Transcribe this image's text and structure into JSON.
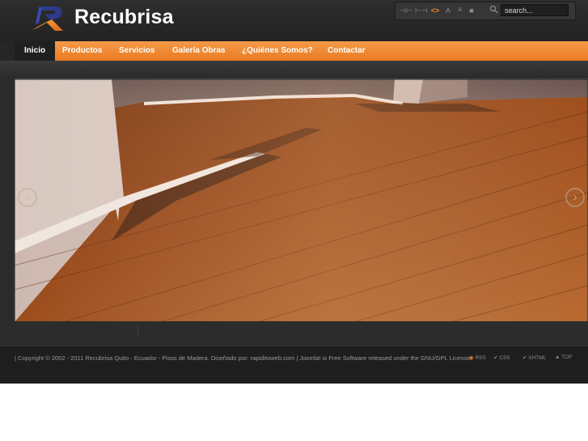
{
  "brand": {
    "name": "Recubrisa",
    "accent_color": "#f08a2a"
  },
  "toolbar": {
    "icons": [
      {
        "name": "decrease-width-icon",
        "glyph": "⊣⊢"
      },
      {
        "name": "increase-width-icon",
        "glyph": "⊢⊣"
      },
      {
        "name": "code-icon",
        "glyph": "<>"
      },
      {
        "name": "font-larger-icon",
        "glyph": "A"
      },
      {
        "name": "font-smaller-icon",
        "glyph": "A"
      },
      {
        "name": "stop-icon",
        "glyph": "■"
      }
    ],
    "search_placeholder": "search..."
  },
  "nav": {
    "items": [
      {
        "label": "Inicio",
        "active": true
      },
      {
        "label": "Productos"
      },
      {
        "label": "Servicios"
      },
      {
        "label": "Galería Obras"
      },
      {
        "label": "¿Quiénes Somos?"
      },
      {
        "label": "Contactar"
      }
    ]
  },
  "slideshow": {
    "prev_glyph": "‹",
    "next_glyph": "›"
  },
  "footer": {
    "copyright": "| Copyright © 2002 - 2011 Recubrisa Quito - Ecuador - Pisos de Madera. Diseñado por: rapiditoweb.com   |  Joomla! is Free Software released under the GNU/GPL License.",
    "links": {
      "rss": "RSS",
      "css": "CSS",
      "xhtml": "XHTML",
      "top": "TOP"
    }
  }
}
